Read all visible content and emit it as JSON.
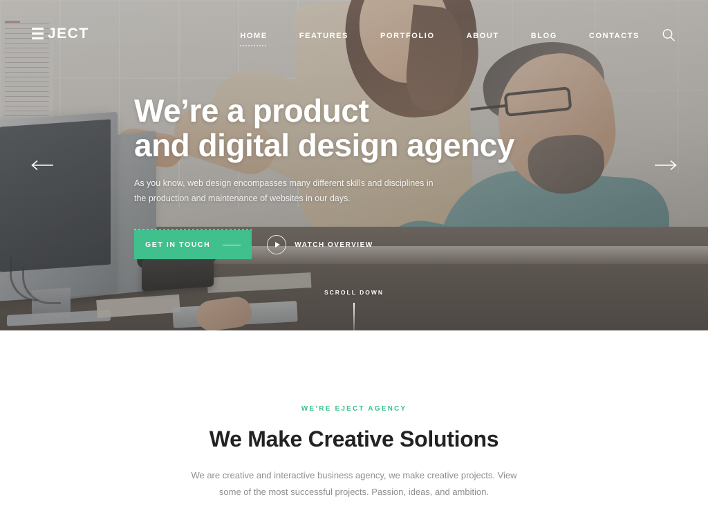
{
  "brand": {
    "logo_text": "JECT",
    "logo_full": "EJECT",
    "accent_color": "#3fc08d"
  },
  "header": {
    "nav": [
      {
        "label": "HOME",
        "active": true
      },
      {
        "label": "FEATURES",
        "active": false
      },
      {
        "label": "PORTFOLIO",
        "active": false
      },
      {
        "label": "ABOUT",
        "active": false
      },
      {
        "label": "BLOG",
        "active": false
      },
      {
        "label": "CONTACTS",
        "active": false
      }
    ],
    "search_icon": "search-icon"
  },
  "hero": {
    "title_line1": "We’re a product",
    "title_line2": "and digital design agency",
    "subtitle": "As you know, web design encompasses many different skills and disciplines in the production and maintenance of websites in our days.",
    "cta_label": "GET IN TOUCH",
    "watch_label": "WATCH OVERVIEW",
    "scroll_label": "SCROLL DOWN",
    "prev_arrow_icon": "arrow-left-icon",
    "next_arrow_icon": "arrow-right-icon",
    "play_icon": "play-icon",
    "background_description": "Office scene: woman standing pointing at monitor, bearded man in teal shirt seated at desk with iMac, desk phone and papers"
  },
  "about": {
    "eyebrow": "WE’RE EJECT AGENCY",
    "title": "We Make Creative Solutions",
    "description": "We are creative and interactive business agency, we make creative projects. View some of the most successful projects. Passion, ideas, and ambition."
  }
}
